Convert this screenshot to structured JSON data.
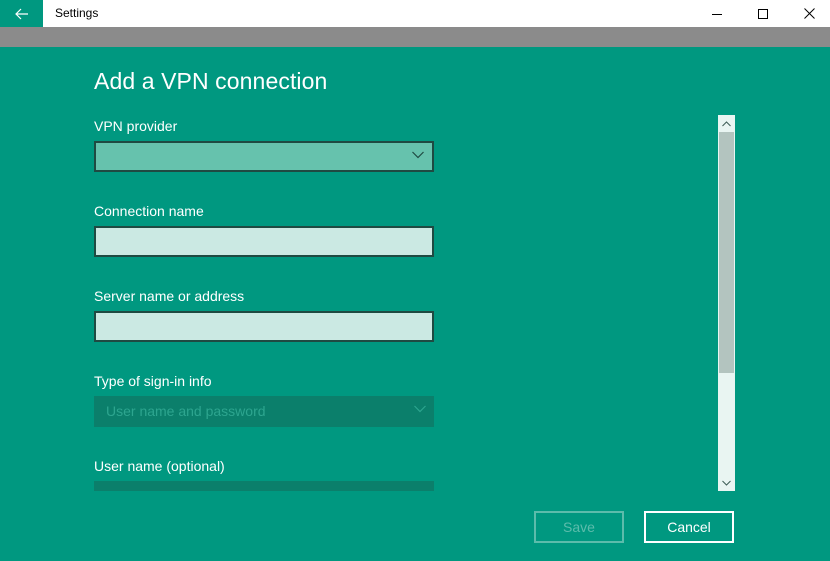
{
  "window": {
    "title": "Settings"
  },
  "page": {
    "title": "Add a VPN connection"
  },
  "form": {
    "vpn_provider": {
      "label": "VPN provider",
      "selected": ""
    },
    "connection_name": {
      "label": "Connection name",
      "value": ""
    },
    "server_name": {
      "label": "Server name or address",
      "value": ""
    },
    "sign_in_type": {
      "label": "Type of sign-in info",
      "selected": "User name and password"
    },
    "user_name": {
      "label": "User name (optional)"
    }
  },
  "buttons": {
    "save_label": "Save",
    "cancel_label": "Cancel"
  },
  "colors": {
    "accent": "#009880",
    "titlebar": "#ffffff",
    "strip": "#8b8b8b",
    "input_background": "#cbe9e3",
    "dropdown_background": "#66c2ad",
    "disabled_dropdown": "#0b7f6b"
  },
  "icons": {
    "back": "arrow-left-icon",
    "minimize": "minimize-icon",
    "maximize": "maximize-icon",
    "close": "close-icon",
    "dropdown": "chevron-down-icon",
    "scroll_up": "chevron-up-icon",
    "scroll_down": "chevron-down-icon"
  },
  "scrollbar": {
    "thumb_fraction": 0.67,
    "position": 0
  }
}
